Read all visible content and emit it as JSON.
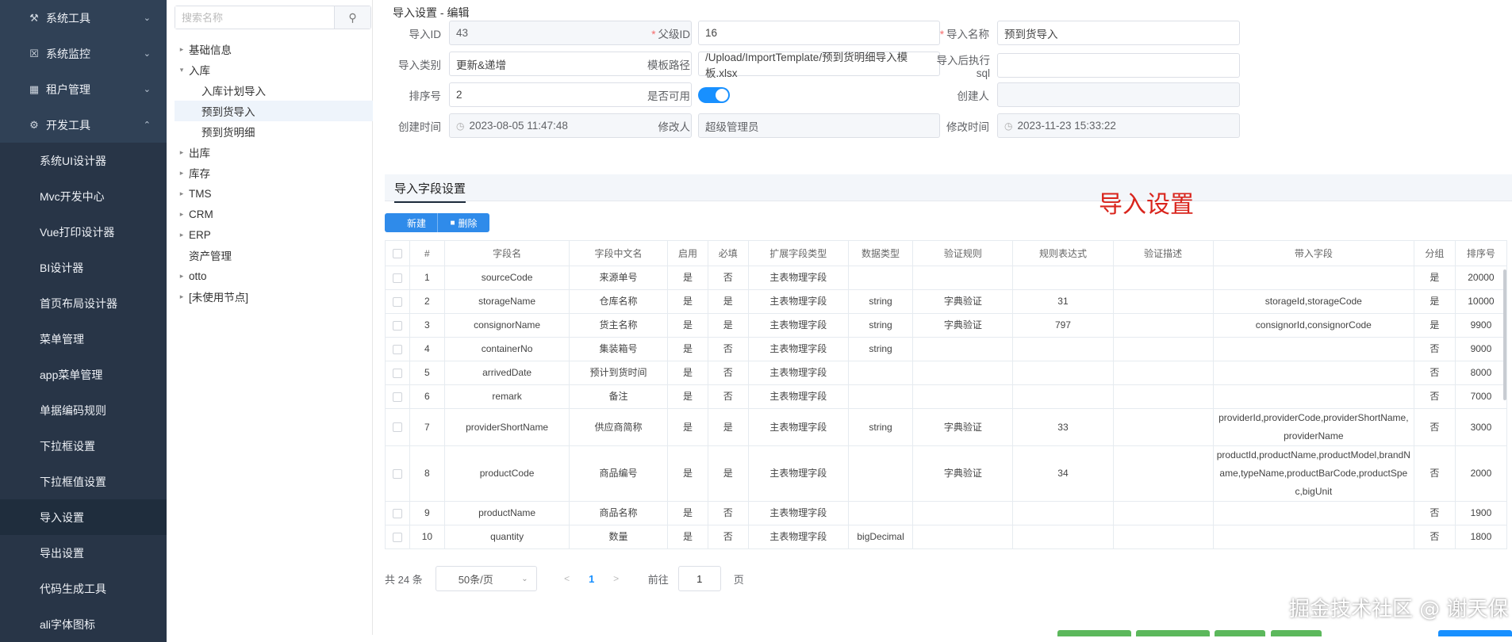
{
  "sidebar": {
    "items": [
      {
        "label": "系统工具",
        "icon": "wrench-icon",
        "arrow": "⌄",
        "type": "top"
      },
      {
        "label": "系统监控",
        "icon": "lock-icon",
        "arrow": "⌄",
        "type": "top"
      },
      {
        "label": "租户管理",
        "icon": "grid-icon",
        "arrow": "⌄",
        "type": "top"
      },
      {
        "label": "开发工具",
        "icon": "gears-icon",
        "arrow": "⌃",
        "type": "top"
      },
      {
        "label": "系统UI设计器",
        "type": "sub"
      },
      {
        "label": "Mvc开发中心",
        "type": "sub"
      },
      {
        "label": "Vue打印设计器",
        "type": "sub"
      },
      {
        "label": "BI设计器",
        "type": "sub"
      },
      {
        "label": "首页布局设计器",
        "type": "sub"
      },
      {
        "label": "菜单管理",
        "type": "sub"
      },
      {
        "label": "app菜单管理",
        "type": "sub"
      },
      {
        "label": "单据编码规则",
        "type": "sub"
      },
      {
        "label": "下拉框设置",
        "type": "sub"
      },
      {
        "label": "下拉框值设置",
        "type": "sub"
      },
      {
        "label": "导入设置",
        "type": "sub",
        "active": true
      },
      {
        "label": "导出设置",
        "type": "sub"
      },
      {
        "label": "代码生成工具",
        "type": "sub"
      },
      {
        "label": "ali字体图标",
        "type": "sub"
      }
    ]
  },
  "tree": {
    "search_placeholder": "搜索名称",
    "nodes": [
      {
        "label": "基础信息",
        "caret": "▸",
        "level": 0
      },
      {
        "label": "入库",
        "caret": "▾",
        "level": 0
      },
      {
        "label": "入库计划导入",
        "caret": "",
        "level": 1
      },
      {
        "label": "预到货导入",
        "caret": "",
        "level": 1,
        "selected": true
      },
      {
        "label": "预到货明细",
        "caret": "",
        "level": 1
      },
      {
        "label": "出库",
        "caret": "▸",
        "level": 0
      },
      {
        "label": "库存",
        "caret": "▸",
        "level": 0
      },
      {
        "label": "TMS",
        "caret": "▸",
        "level": 0
      },
      {
        "label": "CRM",
        "caret": "▸",
        "level": 0
      },
      {
        "label": "ERP",
        "caret": "▸",
        "level": 0
      },
      {
        "label": "资产管理",
        "caret": "",
        "level": 0
      },
      {
        "label": "otto",
        "caret": "▸",
        "level": 0
      },
      {
        "label": "[未使用节点]",
        "caret": "▸",
        "level": 0
      }
    ]
  },
  "page_title": "导入设置 - 编辑",
  "form": {
    "import_id": {
      "label": "导入ID",
      "value": "43"
    },
    "parent_id": {
      "label": "父级ID",
      "value": "16"
    },
    "import_name": {
      "label": "导入名称",
      "value": "预到货导入"
    },
    "import_type": {
      "label": "导入类别",
      "value": "更新&递增"
    },
    "template_path": {
      "label": "模板路径",
      "value": "/Upload/ImportTemplate/预到货明细导入模板.xlsx"
    },
    "after_sql": {
      "label": "导入后执行sql",
      "value": ""
    },
    "sort_no": {
      "label": "排序号",
      "value": "2"
    },
    "enabled": {
      "label": "是否可用",
      "value": true
    },
    "creator": {
      "label": "创建人",
      "value": ""
    },
    "created_time": {
      "label": "创建时间",
      "value": "2023-08-05 11:47:48"
    },
    "modifier": {
      "label": "修改人",
      "value": "超级管理员"
    },
    "modified_time": {
      "label": "修改时间",
      "value": "2023-11-23 15:33:22"
    }
  },
  "tab_label": "导入字段设置",
  "overlay_title": "导入设置",
  "toolbar": {
    "new_label": "新建",
    "delete_label": "删除"
  },
  "table": {
    "headers": [
      "#",
      "字段名",
      "字段中文名",
      "启用",
      "必填",
      "扩展字段类型",
      "数据类型",
      "验证规则",
      "规则表达式",
      "验证描述",
      "带入字段",
      "分组",
      "排序号"
    ],
    "rows": [
      [
        "1",
        "sourceCode",
        "来源单号",
        "是",
        "否",
        "主表物理字段",
        "",
        "",
        "",
        "",
        "",
        "是",
        "20000"
      ],
      [
        "2",
        "storageName",
        "仓库名称",
        "是",
        "是",
        "主表物理字段",
        "string",
        "字典验证",
        "31",
        "",
        "storageId,storageCode",
        "是",
        "10000"
      ],
      [
        "3",
        "consignorName",
        "货主名称",
        "是",
        "是",
        "主表物理字段",
        "string",
        "字典验证",
        "797",
        "",
        "consignorId,consignorCode",
        "是",
        "9900"
      ],
      [
        "4",
        "containerNo",
        "集装箱号",
        "是",
        "否",
        "主表物理字段",
        "string",
        "",
        "",
        "",
        "",
        "否",
        "9000"
      ],
      [
        "5",
        "arrivedDate",
        "预计到货时间",
        "是",
        "否",
        "主表物理字段",
        "",
        "",
        "",
        "",
        "",
        "否",
        "8000"
      ],
      [
        "6",
        "remark",
        "备注",
        "是",
        "否",
        "主表物理字段",
        "",
        "",
        "",
        "",
        "",
        "否",
        "7000"
      ],
      [
        "7",
        "providerShortName",
        "供应商简称",
        "是",
        "是",
        "主表物理字段",
        "string",
        "字典验证",
        "33",
        "",
        "providerId,providerCode,providerShortName,providerName",
        "否",
        "3000"
      ],
      [
        "8",
        "productCode",
        "商品编号",
        "是",
        "是",
        "主表物理字段",
        "",
        "字典验证",
        "34",
        "",
        "productId,productName,productModel,brandName,typeName,productBarCode,productSpec,bigUnit",
        "否",
        "2000"
      ],
      [
        "9",
        "productName",
        "商品名称",
        "是",
        "否",
        "主表物理字段",
        "",
        "",
        "",
        "",
        "",
        "否",
        "1900"
      ],
      [
        "10",
        "quantity",
        "数量",
        "是",
        "否",
        "主表物理字段",
        "bigDecimal",
        "",
        "",
        "",
        "",
        "否",
        "1800"
      ]
    ]
  },
  "pager": {
    "total": "共 24 条",
    "page_size": "50条/页",
    "current": "1",
    "goto_label": "前往",
    "goto_value": "1",
    "goto_unit": "页"
  },
  "watermark": "掘金技术社区 @ 谢天保",
  "colors": {
    "sidebar": "#304156",
    "accent": "#1890ff",
    "red_title": "#d9251d"
  }
}
